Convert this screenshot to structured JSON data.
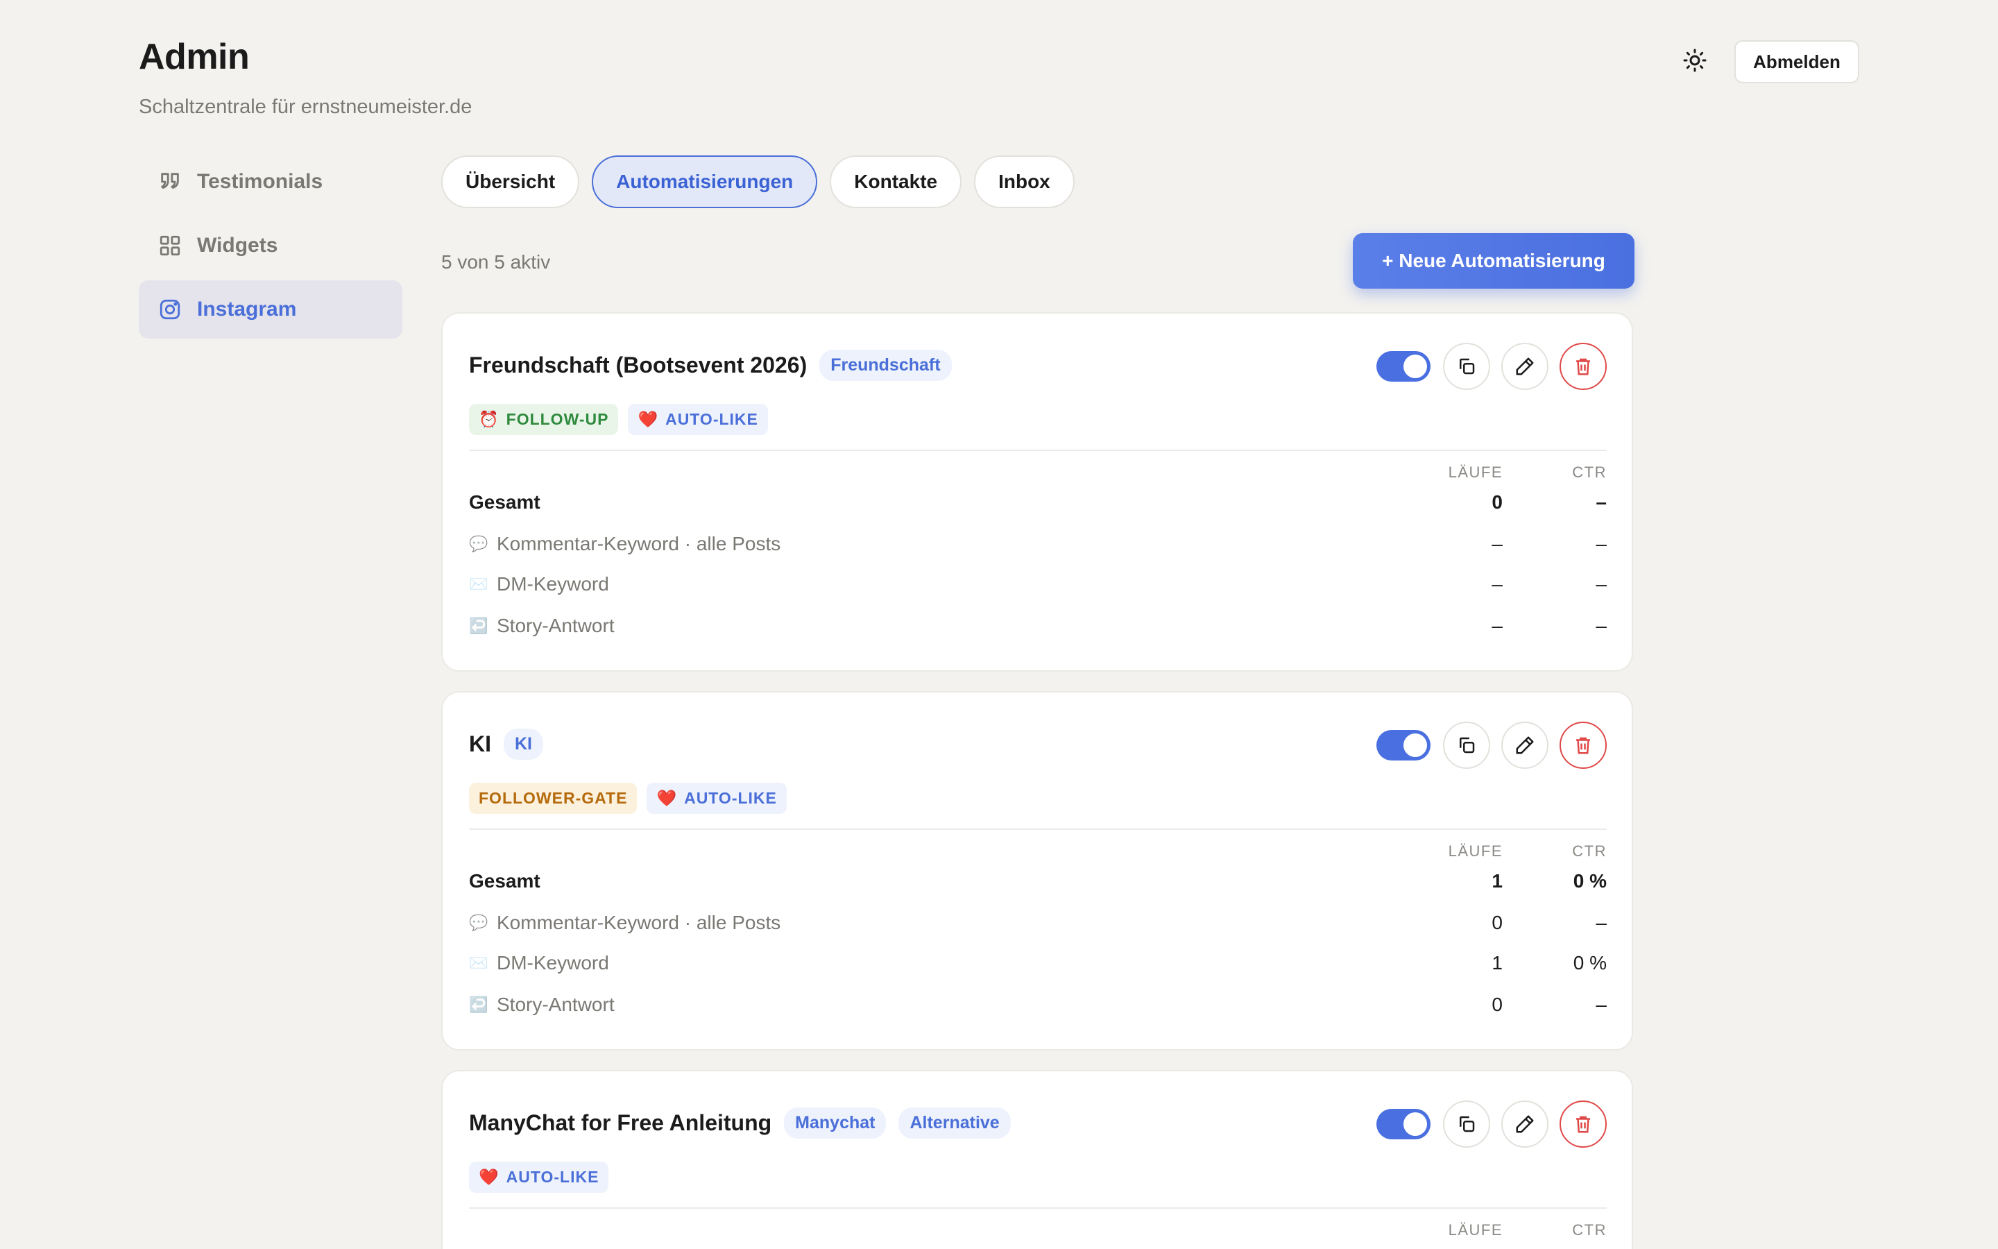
{
  "header": {
    "title": "Admin",
    "subtitle": "Schaltzentrale für ernstneumeister.de",
    "logout_label": "Abmelden",
    "theme_icon": "sun-icon"
  },
  "sidebar": {
    "items": [
      {
        "label": "Testimonials",
        "icon": "quote-icon"
      },
      {
        "label": "Widgets",
        "icon": "grid-icon"
      },
      {
        "label": "Instagram",
        "icon": "instagram-icon",
        "active": true
      }
    ]
  },
  "tabs": [
    {
      "label": "Übersicht"
    },
    {
      "label": "Automatisierungen",
      "active": true
    },
    {
      "label": "Kontakte"
    },
    {
      "label": "Inbox"
    }
  ],
  "toolbar": {
    "active_count": "5 von 5 aktiv",
    "new_button": "+ Neue Automatisierung"
  },
  "columns": {
    "runs": "LÄUFE",
    "ctr": "CTR"
  },
  "cards": [
    {
      "title": "Freundschaft (Bootsevent 2026)",
      "tags": [
        "Freundschaft"
      ],
      "badges": [
        {
          "icon": "⏰",
          "label": "FOLLOW-UP",
          "color": "green"
        },
        {
          "icon": "❤️",
          "label": "AUTO-LIKE",
          "color": "blue"
        }
      ],
      "total": {
        "label": "Gesamt",
        "runs": "0",
        "ctr": "–"
      },
      "rows": [
        {
          "icon": "💬",
          "label": "Kommentar-Keyword · alle Posts",
          "runs": "–",
          "ctr": "–"
        },
        {
          "icon": "✉️",
          "label": "DM-Keyword",
          "runs": "–",
          "ctr": "–"
        },
        {
          "icon": "↩️",
          "label": "Story-Antwort",
          "runs": "–",
          "ctr": "–"
        }
      ]
    },
    {
      "title": "KI",
      "tags": [
        "KI"
      ],
      "badges": [
        {
          "icon": "",
          "label": "FOLLOWER-GATE",
          "color": "orange"
        },
        {
          "icon": "❤️",
          "label": "AUTO-LIKE",
          "color": "blue"
        }
      ],
      "total": {
        "label": "Gesamt",
        "runs": "1",
        "ctr": "0 %"
      },
      "rows": [
        {
          "icon": "💬",
          "label": "Kommentar-Keyword · alle Posts",
          "runs": "0",
          "ctr": "–"
        },
        {
          "icon": "✉️",
          "label": "DM-Keyword",
          "runs": "1",
          "ctr": "0 %"
        },
        {
          "icon": "↩️",
          "label": "Story-Antwort",
          "runs": "0",
          "ctr": "–"
        }
      ]
    },
    {
      "title": "ManyChat for Free Anleitung",
      "tags": [
        "Manychat",
        "Alternative"
      ],
      "badges": [
        {
          "icon": "❤️",
          "label": "AUTO-LIKE",
          "color": "blue"
        }
      ]
    }
  ],
  "colors": {
    "accent": "#4a6fe0",
    "danger": "#e04848",
    "background": "#f3f2ef"
  }
}
